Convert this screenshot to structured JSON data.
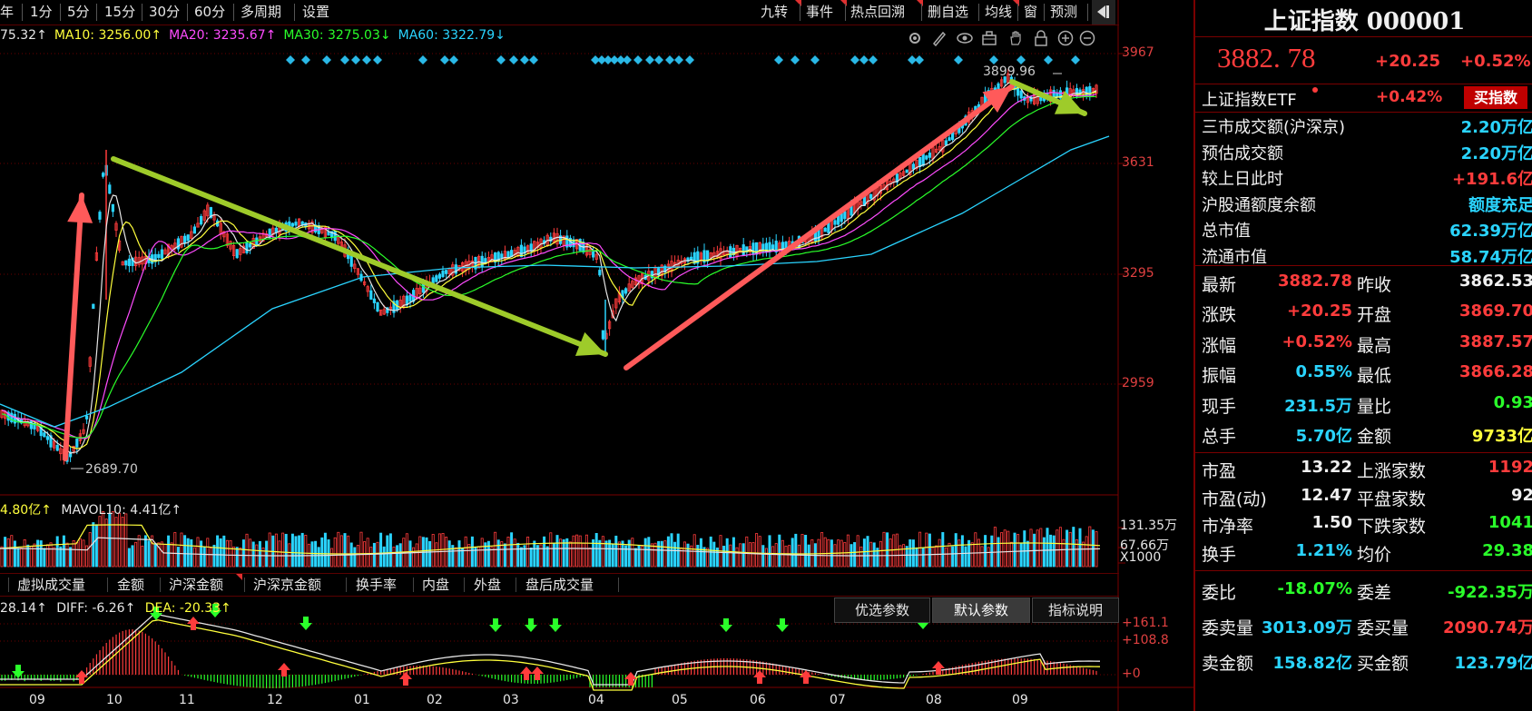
{
  "toolbar": {
    "left_items": [
      "年",
      "1分",
      "5分",
      "15分",
      "30分",
      "60分",
      "多周期",
      "设置"
    ],
    "right_items": [
      "九转",
      "事件",
      "热点回溯",
      "删自选",
      "均线",
      "窗",
      "预测"
    ]
  },
  "ma_legend": {
    "ma5": "75.32↑",
    "ma10": "MA10: 3256.00↑",
    "ma20": "MA20: 3235.67↑",
    "ma30": "MA30: 3275.03↓",
    "ma60": "MA60: 3322.79↓"
  },
  "price_axis": [
    "3967",
    "3631",
    "3295",
    "2959"
  ],
  "annotations": {
    "high": "3899.96",
    "low": "2689.70"
  },
  "volume": {
    "legend_a": "4.80亿↑",
    "legend_b": "MAVOL10: 4.41亿↑",
    "axis": [
      "131.35万",
      "67.66万",
      "X1000"
    ]
  },
  "tabs": [
    "虚拟成交量",
    "金额",
    "沪深金额",
    "沪深京金额",
    "换手率",
    "内盘",
    "外盘",
    "盘后成交量"
  ],
  "macd": {
    "legend_a": "28.14↑",
    "legend_b": "DIFF: -6.26↑",
    "legend_c": "DEA: -20.33↑",
    "axis": [
      "+161.1",
      "+108.8",
      "+0"
    ],
    "buttons": [
      "优选参数",
      "默认参数",
      "指标说明"
    ]
  },
  "months": [
    "09",
    "10",
    "11",
    "12",
    "01",
    "02",
    "03",
    "04",
    "05",
    "06",
    "07",
    "08",
    "09"
  ],
  "panel": {
    "title": "上证指数 000001",
    "price": "3882. 78",
    "change": "+20.25",
    "change_pct": "+0.52%",
    "etf_label": "上证指数ETF",
    "etf_pct": "+0.42%",
    "etf_button": "买指数",
    "stats": [
      {
        "label": "三市成交额(沪深京)",
        "value": "2.20万亿"
      },
      {
        "label": "预估成交额",
        "value": "2.20万亿"
      },
      {
        "label": "较上日此时",
        "value": "+191.6亿"
      },
      {
        "label": "沪股通额度余额",
        "value": "额度充足"
      },
      {
        "label": "总市值",
        "value": "62.39万亿"
      },
      {
        "label": "流通市值",
        "value": "58.74万亿"
      }
    ],
    "quote_rows": [
      {
        "l1": "最新",
        "v1": "3882.78",
        "l2": "昨收",
        "v2": "3862.53"
      },
      {
        "l1": "涨跌",
        "v1": "+20.25",
        "l2": "开盘",
        "v2": "3869.70"
      },
      {
        "l1": "涨幅",
        "v1": "+0.52%",
        "l2": "最高",
        "v2": "3887.57"
      },
      {
        "l1": "振幅",
        "v1": "0.55%",
        "l2": "最低",
        "v2": "3866.28"
      },
      {
        "l1": "现手",
        "v1": "231.5万",
        "l2": "量比",
        "v2": "0.93"
      },
      {
        "l1": "总手",
        "v1": "5.70亿",
        "l2": "金额",
        "v2": "9733亿"
      }
    ],
    "valuation_rows": [
      {
        "l1": "市盈",
        "v1": "13.22",
        "l2": "上涨家数",
        "v2": "1192"
      },
      {
        "l1": "市盈(动)",
        "v1": "12.47",
        "l2": "平盘家数",
        "v2": "92"
      },
      {
        "l1": "市净率",
        "v1": "1.50",
        "l2": "下跌家数",
        "v2": "1041"
      },
      {
        "l1": "换手",
        "v1": "1.21%",
        "l2": "均价",
        "v2": "29.38"
      }
    ],
    "order_rows": [
      {
        "l1": "委比",
        "v1": "-18.07%",
        "l2": "委差",
        "v2": "-922.35万"
      },
      {
        "l1": "委卖量",
        "v1": "3013.09万",
        "l2": "委买量",
        "v2": "2090.74万"
      },
      {
        "l1": "卖金额",
        "v1": "158.82亿",
        "l2": "买金额",
        "v2": "123.79亿"
      }
    ]
  }
}
